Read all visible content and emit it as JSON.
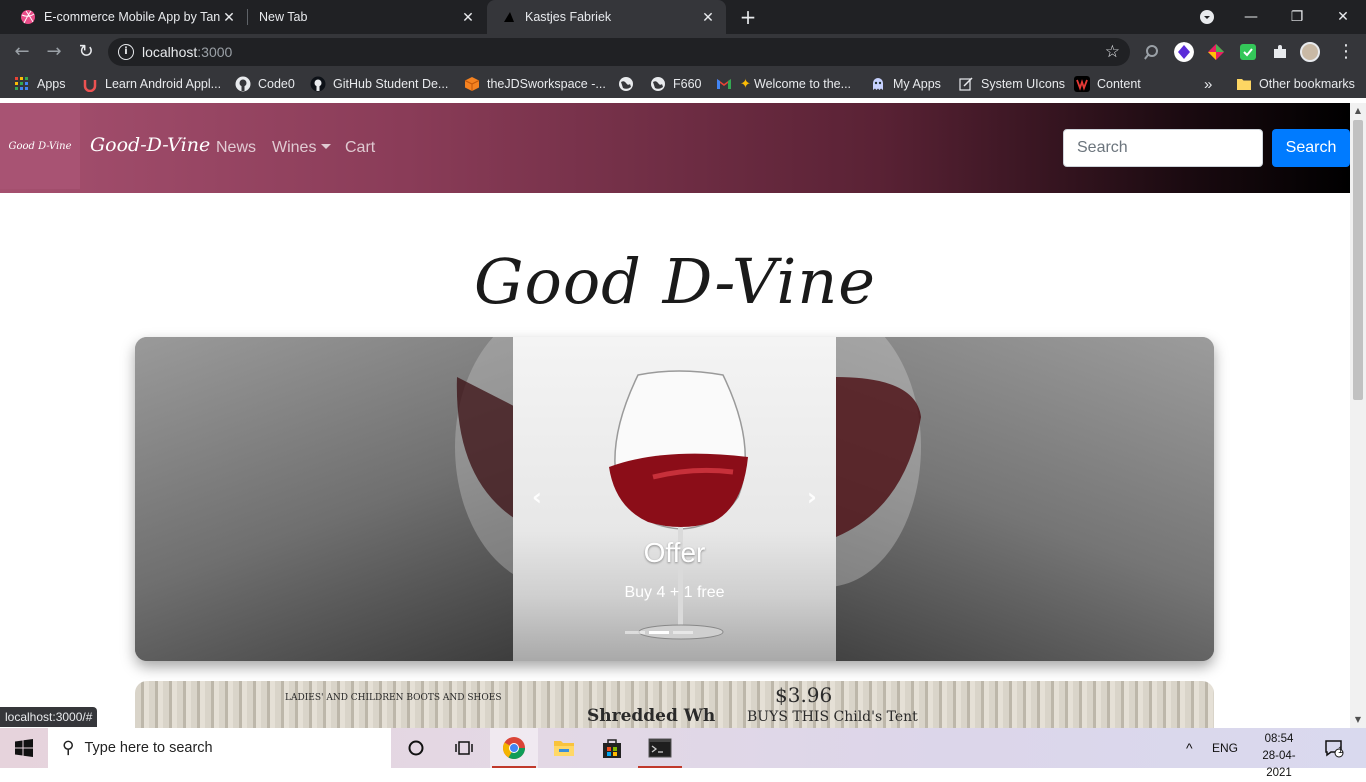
{
  "browser": {
    "tabs": [
      {
        "title": "E-commerce Mobile App by Tanb",
        "close": "✕"
      },
      {
        "title": "New Tab",
        "close": "✕"
      },
      {
        "title": "Kastjes Fabriek",
        "close": "✕"
      }
    ],
    "new_tab": "+",
    "window_controls": {
      "minimize": "—",
      "restore": "❐",
      "close": "✕"
    },
    "nav": {
      "back": "←",
      "forward": "→",
      "reload": "↻"
    },
    "url_host": "localhost",
    "url_port": ":3000",
    "star": "☆",
    "bookmarks": [
      {
        "label": "Apps",
        "icon": "apps-grid-icon"
      },
      {
        "label": "Learn Android Appl...",
        "icon": "udemy-icon"
      },
      {
        "label": "Code0",
        "icon": "github-icon"
      },
      {
        "label": "GitHub Student De...",
        "icon": "github-icon"
      },
      {
        "label": "theJDSworkspace -...",
        "icon": "cube-icon"
      },
      {
        "label": "",
        "icon": "globe-icon"
      },
      {
        "label": "F660",
        "icon": "globe-icon"
      },
      {
        "label": "",
        "icon": "gmail-icon"
      },
      {
        "label": "Welcome to the...",
        "icon": "sparkle-icon"
      },
      {
        "label": "My Apps",
        "icon": "ghost-icon"
      },
      {
        "label": "System UIcons",
        "icon": "edit-icon"
      },
      {
        "label": "Content",
        "icon": "wix-icon"
      }
    ],
    "more_bookmarks": "»",
    "other_bookmarks": "Other bookmarks",
    "status_url": "localhost:3000/#"
  },
  "site": {
    "logo_text": "Good D-Vine",
    "brand": "Good-D-Vine",
    "nav_links": {
      "news": "News",
      "wines": "Wines",
      "cart": "Cart"
    },
    "search_placeholder": "Search",
    "search_button": "Search",
    "hero_title": "Good D-Vine",
    "carousel": {
      "prev": "‹",
      "next": "›",
      "caption_title": "Offer",
      "caption_text": "Buy 4 + 1 free",
      "active_slide": 1,
      "slide_count": 3
    },
    "news_card": {
      "text_left": "LADIES' AND CHILDREN BOOTS AND SHOES",
      "text_center": "Shredded Wh",
      "text_right": "BUYS THIS Child's Tent",
      "price": "$3.96"
    }
  },
  "taskbar": {
    "search_placeholder": "Type here to search",
    "language": "ENG",
    "time": "08:54",
    "date": "28-04-2021",
    "notification_count": "1",
    "tray_up": "^"
  },
  "colors": {
    "nav_gradient_start": "#a5506f",
    "nav_gradient_end": "#000000",
    "search_button": "#007bff",
    "chrome_dark": "#202124",
    "chrome_toolbar": "#35363a"
  }
}
